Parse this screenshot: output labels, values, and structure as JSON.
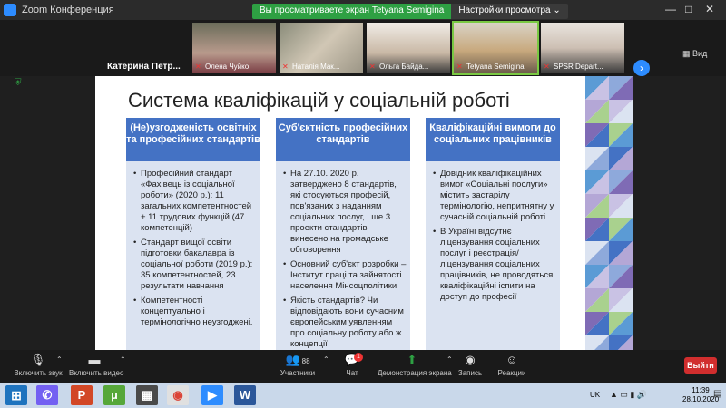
{
  "window": {
    "title": "Zoom Конференция",
    "controls": [
      "—",
      "□",
      "✕"
    ]
  },
  "share_banner": {
    "message": "Вы просматриваете экран Tetyana Semigina",
    "options_label": "Настройки просмотра"
  },
  "gallery": {
    "self_name": "Катерина  Петр...",
    "participants": [
      {
        "name": "Олена Чуйко"
      },
      {
        "name": "Наталія Мак..."
      },
      {
        "name": "Ольга Байда..."
      },
      {
        "name": "Tetyana Semigina"
      },
      {
        "name": "SPSR Depart..."
      }
    ],
    "view_label": "Вид"
  },
  "slide": {
    "title": "Система кваліфікацій у соціальній роботі",
    "columns": [
      {
        "heading": "(Не)узгодженість освітніх та професійних стандартів",
        "bullets": [
          "Професійний стандарт «Фахівець із соціальної роботи» (2020 р.): 11 загальних компетентностей + 11 трудових функцій (47 компетенцій)",
          "Стандарт вищої освіти підготовки бакалавра із соціальної роботи (2019 р.): 35 компетентностей, 23 результати навчання",
          "Компетентності концептуально і термінологічно неузгоджені."
        ]
      },
      {
        "heading": "Суб'єктність професійних стандартів",
        "bullets": [
          "На 27.10. 2020 р. затверджено 8 стандартів, які стосуються професій, пов'язаних з наданням соціальних послуг, і ще 3 проекти стандартів винесено на громадське обговорення",
          "Основний суб'єкт розробки – Інститут праці та зайнятості населення Мінсоцполітики",
          "Якість стандартів? Чи відповідають вони сучасним європейським уявленням про соціальну роботу або ж концепції"
        ]
      },
      {
        "heading": "Кваліфікаційні вимоги до соціальних працівників",
        "bullets": [
          "Довідник кваліфікаційних вимог «Соціальні послуги» містить застарілу термінологію, непритнятну у сучасній соціальній роботі",
          "В Україні відсутнє ліцензування соціальних послуг і реєстрація/ ліцензування соціальних працівників, не проводяться кваліфікаційні іспити на доступ до професії"
        ]
      }
    ]
  },
  "toolbar": {
    "mute": "Включить звук",
    "video": "Включить видео",
    "participants": "Участники",
    "participants_count": "88",
    "chat": "Чат",
    "chat_badge": "1",
    "share": "Демонстрация экрана",
    "record": "Запись",
    "reactions": "Реакции",
    "end": "Выйти"
  },
  "taskbar": {
    "lang": "UK",
    "time": "11:39",
    "date": "28.10.2020",
    "apps": [
      "viber-icon",
      "powerpoint-icon",
      "utorrent-icon",
      "calculator-icon",
      "chrome-icon",
      "zoom-icon",
      "word-icon"
    ]
  },
  "colors": {
    "accent": "#4472c4",
    "column_bg": "#dbe3f1",
    "share_green": "#2ea043",
    "end_red": "#d12e2e",
    "zoom_blue": "#2d8cff"
  }
}
